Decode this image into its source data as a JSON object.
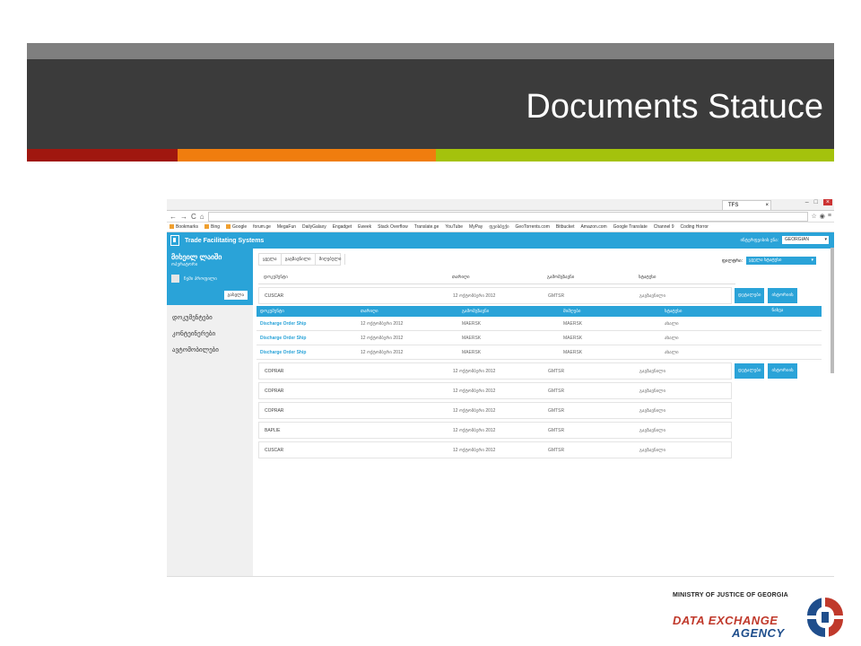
{
  "slide": {
    "title": "Documents Statuce",
    "colors": {
      "band": "#3b3b3b",
      "stripe_red": "#a0170f",
      "stripe_orange": "#f07d0e",
      "stripe_green": "#a4c20c"
    }
  },
  "browser": {
    "tab_title": "TFS",
    "bookmarks": [
      "Bookmarks",
      "Bing",
      "Google",
      "forum.ge",
      "MegaFun",
      "DailyGalaxy",
      "Engadget",
      "Eweek",
      "Stack Overflow",
      "Translate.ge",
      "YouTube",
      "MyPay",
      "ფეისბუქი",
      "GeoTorrents.com",
      "Bitbucket",
      "Amazon.com",
      "Google Translate",
      "Channel 9",
      "Coding Horror"
    ]
  },
  "app": {
    "title": "Trade Facilitating Systems",
    "accent": "#2aa3d8",
    "lang_label": "ინტერფეისის ენა:",
    "lang_value": "GEORGIAN"
  },
  "sidebar": {
    "user_name": "მიხეილ ლაიში",
    "user_sub": "ოპერატორი",
    "profile_link": "ჩემი პროფილი",
    "logout": "გასვლა",
    "items": [
      "დოკუმენტები",
      "კონტეინერები",
      "ავტომობილები"
    ]
  },
  "main": {
    "tabs": [
      "ყველა",
      "გაგზავნილი",
      "მიღებული"
    ],
    "filter_label": "ფილტრი:",
    "filter_value": "ყველა სტატუსი",
    "columns": [
      "დოკუმენტი",
      "თარიღი",
      "გამომგზავნი",
      "სტატუსი"
    ],
    "btn_details": "დეტალები",
    "btn_history": "ისტორიის ნახვა",
    "rows": [
      {
        "doc": "CUSCAR",
        "date": "12 ოქტომბერი 2012",
        "sender": "GMTSR",
        "status": "გაგზავნილი"
      },
      {
        "doc": "COPRAR",
        "date": "12 ოქტომბერი 2012",
        "sender": "GMTSR",
        "status": "გაგზავნილი"
      },
      {
        "doc": "COPRAR",
        "date": "12 ოქტომბერი 2012",
        "sender": "GMTSR",
        "status": "გაგზავნილი"
      },
      {
        "doc": "COPRAR",
        "date": "12 ოქტომბერი 2012",
        "sender": "GMTSR",
        "status": "გაგზავნილი"
      },
      {
        "doc": "BAPLIE",
        "date": "12 ოქტომბერი 2012",
        "sender": "GMTSR",
        "status": "გაგზავნილი"
      },
      {
        "doc": "CUSCAR",
        "date": "12 ოქტომბერი 2012",
        "sender": "GMTSR",
        "status": "გაგზავნილი"
      }
    ],
    "sub_columns": [
      "დოკუმენტი",
      "თარიღი",
      "გამომგზავნი",
      "მიმღები",
      "სტატუსი"
    ],
    "sub_rows": [
      {
        "doc": "Discharge Order Ship",
        "date": "12 ოქტომბერი 2012",
        "sender": "MAERSK",
        "receiver": "MAERSK",
        "status": "ახალი"
      },
      {
        "doc": "Discharge Order Ship",
        "date": "12 ოქტომბერი 2012",
        "sender": "MAERSK",
        "receiver": "MAERSK",
        "status": "ახალი"
      },
      {
        "doc": "Discharge Order Ship",
        "date": "12 ოქტომბერი 2012",
        "sender": "MAERSK",
        "receiver": "MAERSK",
        "status": "ახალი"
      }
    ]
  },
  "logo": {
    "line1": "MINISTRY OF JUSTICE OF GEORGIA",
    "line2": "DATA EXCHANGE",
    "line3": "AGENCY"
  }
}
